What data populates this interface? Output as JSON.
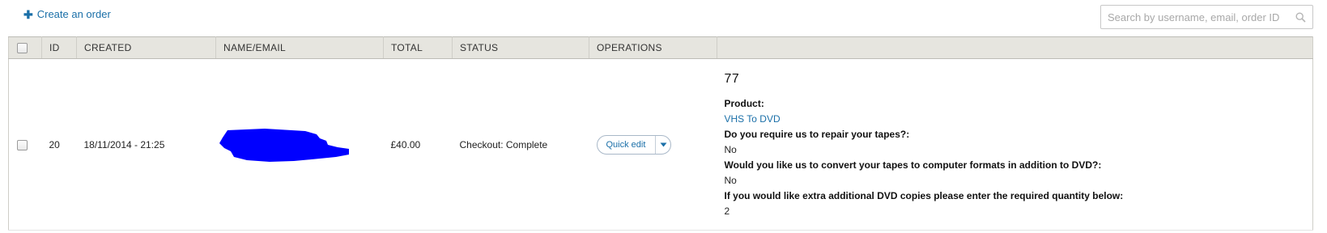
{
  "toolbar": {
    "create_label": "Create an order",
    "search_placeholder": "Search by username, email, order ID",
    "search_value": ""
  },
  "table": {
    "headers": [
      "ID",
      "CREATED",
      "NAME/EMAIL",
      "TOTAL",
      "STATUS",
      "OPERATIONS",
      ""
    ],
    "rows": [
      {
        "id": "20",
        "created": "18/11/2014 - 21:25",
        "name_email": "",
        "total": "£40.00",
        "status": "Checkout: Complete",
        "operations_label": "Quick edit",
        "details": {
          "order_number": "77",
          "product_label": "Product:",
          "product_value": "VHS To DVD",
          "q1_label": "Do you require us to repair your tapes?:",
          "q1_value": "No",
          "q2_label": "Would you like us to convert your tapes to computer formats in addition to DVD?:",
          "q2_value": "No",
          "q3_label": "If you would like extra additional DVD copies please enter the required quantity below:",
          "q3_value": "2"
        }
      }
    ]
  },
  "colors": {
    "link": "#1a6fa8",
    "header_bg": "#e6e5df",
    "redaction": "#0000ff"
  },
  "icons": {
    "create": "plus-icon",
    "search": "search-icon",
    "dropdown": "chevron-down-icon"
  }
}
